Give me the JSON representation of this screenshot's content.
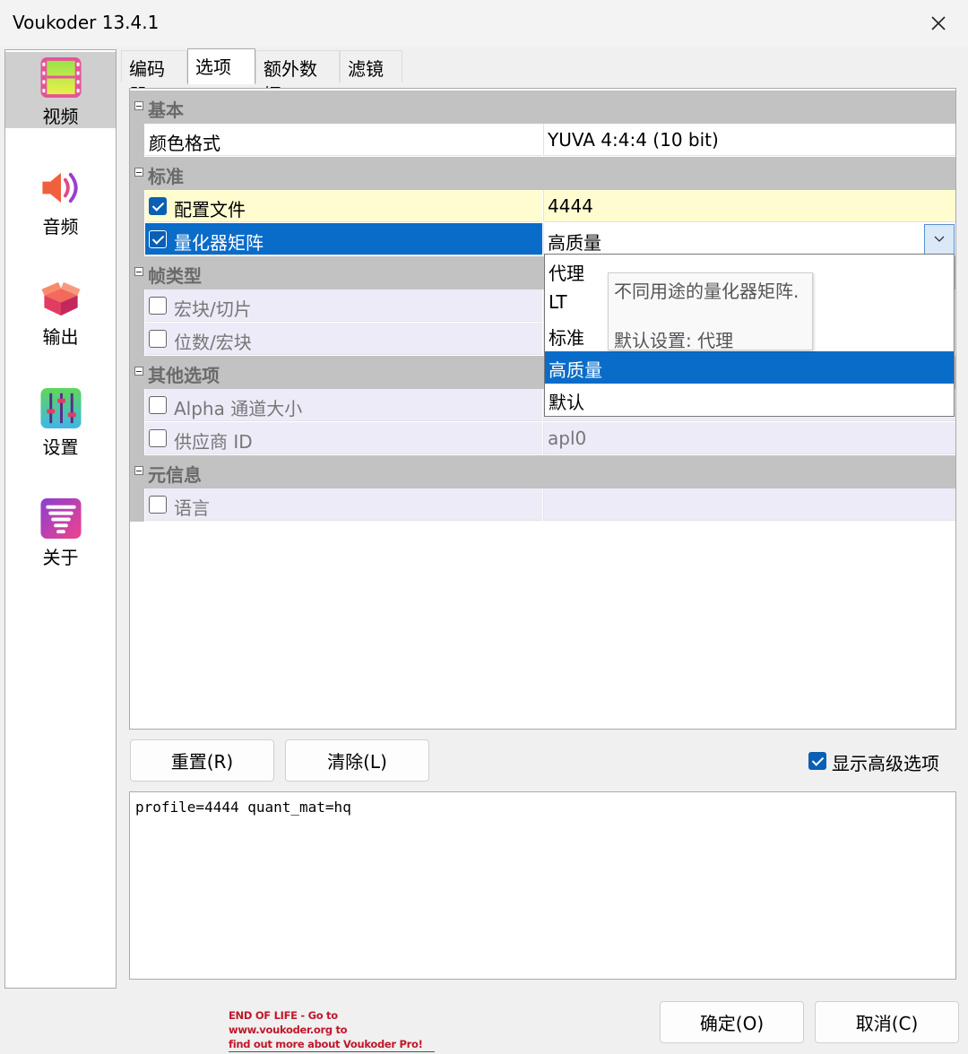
{
  "window": {
    "title": "Voukoder 13.4.1",
    "close_symbol": "✕"
  },
  "sidebar": {
    "items": [
      {
        "label": "视频",
        "icon": "video-icon",
        "active": true
      },
      {
        "label": "音频",
        "icon": "speaker-icon",
        "active": false
      },
      {
        "label": "输出",
        "icon": "box-icon",
        "active": false
      },
      {
        "label": "设置",
        "icon": "sliders-icon",
        "active": false
      },
      {
        "label": "关于",
        "icon": "tornado-icon",
        "active": false
      }
    ]
  },
  "tabs": [
    {
      "label": "编码器",
      "active": false
    },
    {
      "label": "选项",
      "active": true
    },
    {
      "label": "额外数据",
      "active": false
    },
    {
      "label": "滤镜",
      "active": false
    }
  ],
  "grid": {
    "basic": {
      "category": "基本",
      "color_format": {
        "name": "颜色格式",
        "value": "YUVA 4:4:4 (10 bit)"
      }
    },
    "standard": {
      "category": "标准",
      "profile": {
        "name": "配置文件",
        "value": "4444",
        "checked": true
      },
      "quant_matrix": {
        "name": "量化器矩阵",
        "value": "高质量",
        "checked": true
      }
    },
    "frame_type": {
      "category": "帧类型",
      "macroblock_slice": {
        "name": "宏块/切片",
        "checked": false
      },
      "bits_per_mb": {
        "name": "位数/宏块",
        "checked": false
      }
    },
    "other": {
      "category": "其他选项",
      "alpha_bits": {
        "name": "Alpha 通道大小",
        "checked": false
      },
      "vendor_id": {
        "name": "供应商 ID",
        "value": "apl0",
        "checked": false
      }
    },
    "meta": {
      "category": "元信息",
      "language": {
        "name": "语言",
        "checked": false
      }
    }
  },
  "dropdown": {
    "options": [
      "代理",
      "LT",
      "标准",
      "高质量",
      "默认"
    ],
    "selected_index": 3
  },
  "tooltip": {
    "line1": "不同用途的量化器矩阵.",
    "line2": "默认设置: 代理"
  },
  "buttons": {
    "reset": "重置(R)",
    "clear": "清除(L)",
    "ok": "确定(O)",
    "cancel": "取消(C)"
  },
  "advanced": {
    "label": "显示高级选项",
    "checked": true
  },
  "command_line": "profile=4444 quant_mat=hq",
  "footer": {
    "eol_line1": "END OF LIFE - Go to www.voukoder.org to",
    "eol_line2": "find out more about Voukoder Pro!",
    "eol_color": "#c0182a"
  },
  "colors": {
    "accent": "#0a6cc9",
    "category_bg": "#c2c2c2",
    "highlight_yellow": "#fffdd0"
  }
}
